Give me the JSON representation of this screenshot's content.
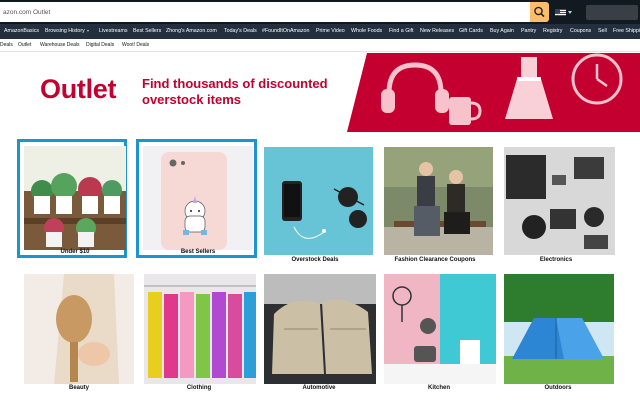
{
  "search": {
    "value": "azon.com Outlet"
  },
  "nav": {
    "items": [
      {
        "label": "AmazonBasics"
      },
      {
        "label": "Browsing History"
      },
      {
        "label": "Livestreams"
      },
      {
        "label": "Best Sellers"
      },
      {
        "label": "Zhong's Amazon.com"
      },
      {
        "label": "Today's Deals"
      },
      {
        "label": "#FoundItOnAmazon"
      },
      {
        "label": "Prime Video"
      },
      {
        "label": "Whole Foods"
      },
      {
        "label": "Find a Gift"
      },
      {
        "label": "New Releases"
      },
      {
        "label": "Gift Cards"
      },
      {
        "label": "Buy Again"
      },
      {
        "label": "Pantry"
      },
      {
        "label": "Registry"
      },
      {
        "label": "Coupons"
      },
      {
        "label": "Sell"
      },
      {
        "label": "Free Shipping"
      }
    ]
  },
  "subnav": {
    "items": [
      {
        "label": "Deals"
      },
      {
        "label": "Outlet"
      },
      {
        "label": "Warehouse Deals"
      },
      {
        "label": "Digital Deals"
      },
      {
        "label": "Woot! Deals"
      }
    ]
  },
  "hero": {
    "title": "Outlet",
    "tagline": "Find thousands of discounted overstock items"
  },
  "tiles": [
    {
      "label": "Under $10"
    },
    {
      "label": "Best Sellers"
    },
    {
      "label": "Overstock Deals"
    },
    {
      "label": "Fashion Clearance Coupons"
    },
    {
      "label": "Electronics"
    },
    {
      "label": "Beauty"
    },
    {
      "label": "Clothing"
    },
    {
      "label": "Automotive"
    },
    {
      "label": "Kitchen"
    },
    {
      "label": "Outdoors"
    }
  ],
  "colors": {
    "brand_red": "#c3002f",
    "selection_blue": "#1a95d1",
    "nav_bg": "#232f3e",
    "search_button": "#febd69"
  }
}
